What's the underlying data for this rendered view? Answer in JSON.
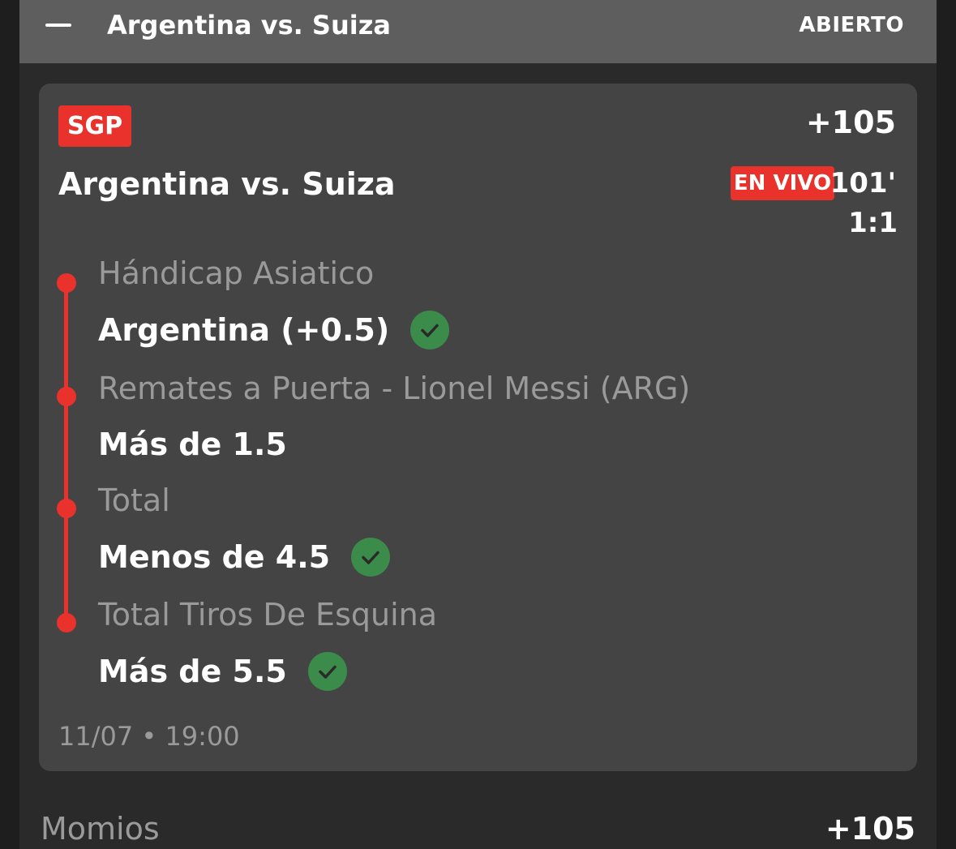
{
  "header": {
    "title": "Argentina vs. Suiza",
    "status": "ABIERTO"
  },
  "card": {
    "badge": "SGP",
    "odds": "+105",
    "match": "Argentina vs. Suiza",
    "live_badge": "EN VIVO",
    "minute": "101'",
    "score": "1:1",
    "legs": [
      {
        "market": "Hándicap Asiatico",
        "pick": "Argentina (+0.5)",
        "settled": true
      },
      {
        "market": "Remates a Puerta - Lionel Messi (ARG)",
        "pick": "Más de 1.5",
        "settled": false
      },
      {
        "market": "Total",
        "pick": "Menos de 4.5",
        "settled": true
      },
      {
        "market": "Total Tiros De Esquina",
        "pick": "Más de 5.5",
        "settled": true
      }
    ],
    "datetime": "11/07 • 19:00"
  },
  "footer": {
    "label": "Momios",
    "odds": "+105"
  },
  "colors": {
    "accent_red": "#e8322b",
    "check_green": "#3b8c4a",
    "card_bg": "#454445",
    "header_bg": "#5e5e5e"
  },
  "icons": {
    "collapse": "minus-icon",
    "won": "check-circle-icon"
  }
}
